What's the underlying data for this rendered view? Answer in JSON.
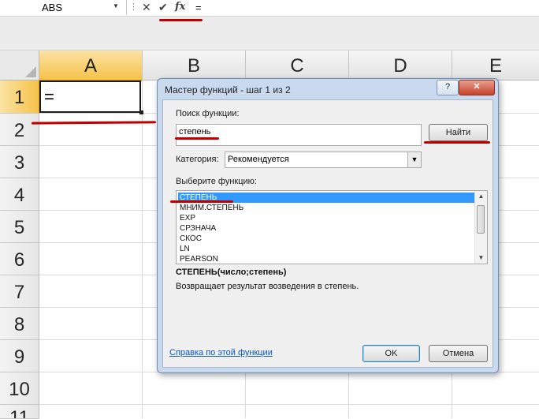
{
  "formula_bar": {
    "name_box": "ABS",
    "cancel_glyph": "✕",
    "enter_glyph": "✔",
    "fx_label": "fx",
    "formula": "="
  },
  "sheet": {
    "columns": [
      "A",
      "B",
      "C",
      "D",
      "E"
    ],
    "rows": [
      "1",
      "2",
      "3",
      "4",
      "5",
      "6",
      "7",
      "8",
      "9",
      "10",
      "11"
    ],
    "active_cell_value": "="
  },
  "dialog": {
    "title": "Мастер функций - шаг 1 из 2",
    "help_button": "?",
    "close_button": "✕",
    "search_label": "Поиск функции:",
    "search_value": "степень",
    "find_button": "Найти",
    "category_label": "Категория:",
    "category_value": "Рекомендуется",
    "select_label": "Выберите функцию:",
    "functions": [
      "СТЕПЕНЬ",
      "МНИМ.СТЕПЕНЬ",
      "EXP",
      "СРЗНАЧА",
      "СКОС",
      "LN",
      "PEARSON"
    ],
    "selected_index": 0,
    "signature": "СТЕПЕНЬ(число;степень)",
    "description": "Возвращает результат возведения в степень.",
    "help_link": "Справка по этой функции",
    "ok_button": "OK",
    "cancel_button": "Отмена"
  },
  "colors": {
    "annotation_red": "#c00000",
    "selection_blue": "#3399ff",
    "active_header": "#f6c24a"
  }
}
